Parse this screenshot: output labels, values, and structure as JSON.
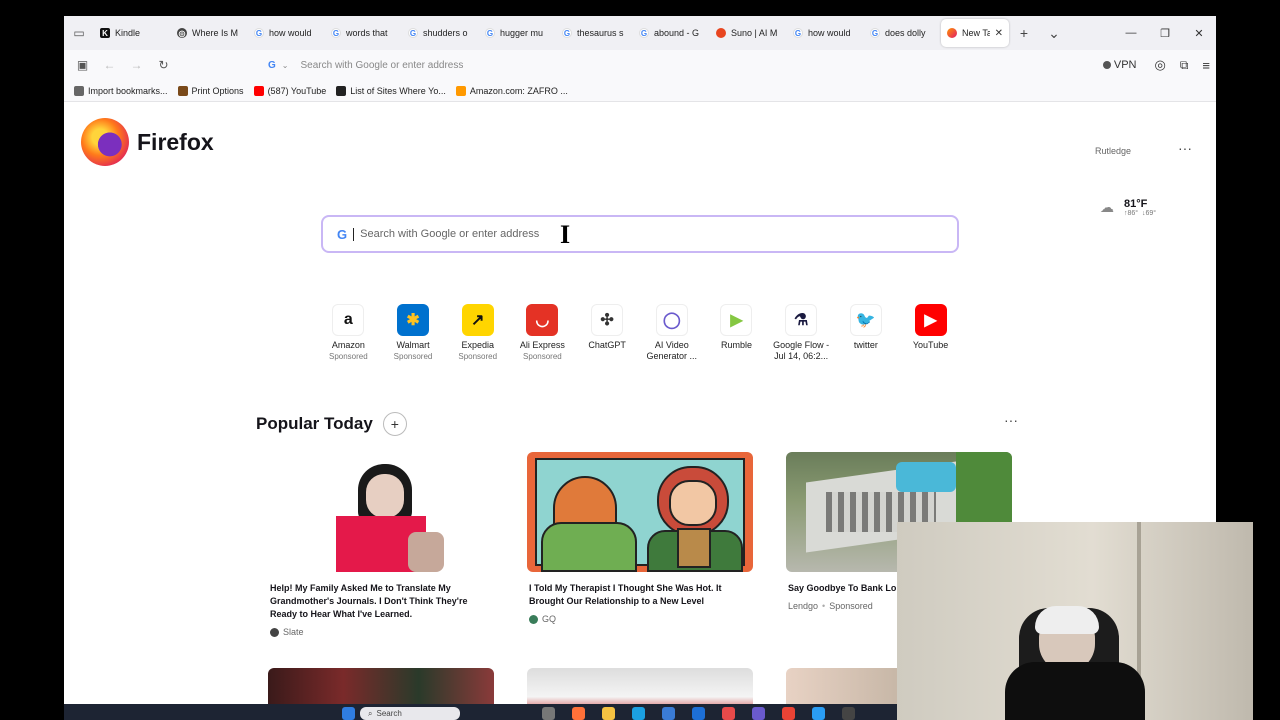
{
  "tabs": [
    {
      "title": "Kindle",
      "favicon": "kindle-icon"
    },
    {
      "title": "Where Is M",
      "favicon": "web-icon"
    },
    {
      "title": "how would",
      "favicon": "google-icon"
    },
    {
      "title": "words that",
      "favicon": "google-icon"
    },
    {
      "title": "shudders o",
      "favicon": "google-icon"
    },
    {
      "title": "hugger mu",
      "favicon": "google-icon"
    },
    {
      "title": "thesaurus s",
      "favicon": "google-icon"
    },
    {
      "title": "abound - G",
      "favicon": "google-icon"
    },
    {
      "title": "Suno | AI M",
      "favicon": "suno-icon"
    },
    {
      "title": "how would",
      "favicon": "google-icon"
    },
    {
      "title": "does dolly",
      "favicon": "google-icon"
    },
    {
      "title": "New Tab",
      "favicon": "firefox-icon",
      "active": true
    }
  ],
  "navbar": {
    "url_placeholder": "Search with Google or enter address",
    "engine_letter": "G",
    "vpn_label": "VPN"
  },
  "bookmarks": [
    {
      "label": "Import bookmarks...",
      "color": "#666666"
    },
    {
      "label": "Print Options",
      "color": "#7a4a1a"
    },
    {
      "label": "(587) YouTube",
      "color": "#ff0000"
    },
    {
      "label": "List of Sites Where Yo...",
      "color": "#222222"
    },
    {
      "label": "Amazon.com: ZAFRO ...",
      "color": "#ff9900"
    }
  ],
  "page": {
    "logo_text": "Firefox",
    "user_name": "Rutledge",
    "menu_glyph": "···",
    "weather": {
      "temp": "81°F",
      "high": "↑86°",
      "low": "↓69°"
    },
    "search_placeholder": "Search with Google or enter address",
    "search_engine_letter": "G"
  },
  "shortcuts": [
    {
      "label": "Amazon",
      "sub": "Sponsored",
      "icon": "amazon-icon",
      "glyph": "a",
      "bg": "#ffffff",
      "fg": "#111111"
    },
    {
      "label": "Walmart",
      "sub": "Sponsored",
      "icon": "walmart-icon",
      "glyph": "✱",
      "bg": "#0071ce",
      "fg": "#ffc220"
    },
    {
      "label": "Expedia",
      "sub": "Sponsored",
      "icon": "expedia-icon",
      "glyph": "↗",
      "bg": "#ffd500",
      "fg": "#111111"
    },
    {
      "label": "Ali Express",
      "sub": "Sponsored",
      "icon": "aliexpress-icon",
      "glyph": "◡",
      "bg": "#e43225",
      "fg": "#ffffff"
    },
    {
      "label": "ChatGPT",
      "sub": "",
      "icon": "chatgpt-icon",
      "glyph": "✣",
      "bg": "#ffffff",
      "fg": "#333333"
    },
    {
      "label": "AI Video Generator ...",
      "sub": "",
      "icon": "ai-video-icon",
      "glyph": "◯",
      "bg": "#ffffff",
      "fg": "#6a5acd"
    },
    {
      "label": "Rumble",
      "sub": "",
      "icon": "rumble-icon",
      "glyph": "▶",
      "bg": "#ffffff",
      "fg": "#85c742"
    },
    {
      "label": "Google Flow - Jul 14, 06:2...",
      "sub": "",
      "icon": "flask-icon",
      "glyph": "⚗",
      "bg": "#ffffff",
      "fg": "#1a1a40"
    },
    {
      "label": "twitter",
      "sub": "",
      "icon": "twitter-icon",
      "glyph": "🐦",
      "bg": "#ffffff",
      "fg": "#1da1f2"
    },
    {
      "label": "YouTube",
      "sub": "",
      "icon": "youtube-icon",
      "glyph": "▶",
      "bg": "#ff0000",
      "fg": "#ffffff"
    }
  ],
  "popular": {
    "heading": "Popular Today",
    "plus_glyph": "+",
    "cards": [
      {
        "title": "Help! My Family Asked Me to Translate My Grandmother's Journals. I Don't Think They're Ready to Hear What I've Learned.",
        "source": "Slate"
      },
      {
        "title": "I Told My Therapist I Thought She Was Hot. It Brought Our Relationship to a New Level",
        "source": "GQ"
      },
      {
        "title": "Say Goodbye To Bank Lo Borrow From Your Self (It",
        "source": "Lendgo",
        "sponsored": "Sponsored"
      }
    ]
  },
  "taskbar": {
    "search_label": "Search"
  },
  "colors": {
    "accent": "#c9b7f5",
    "tabbar": "#f0f0f4"
  }
}
